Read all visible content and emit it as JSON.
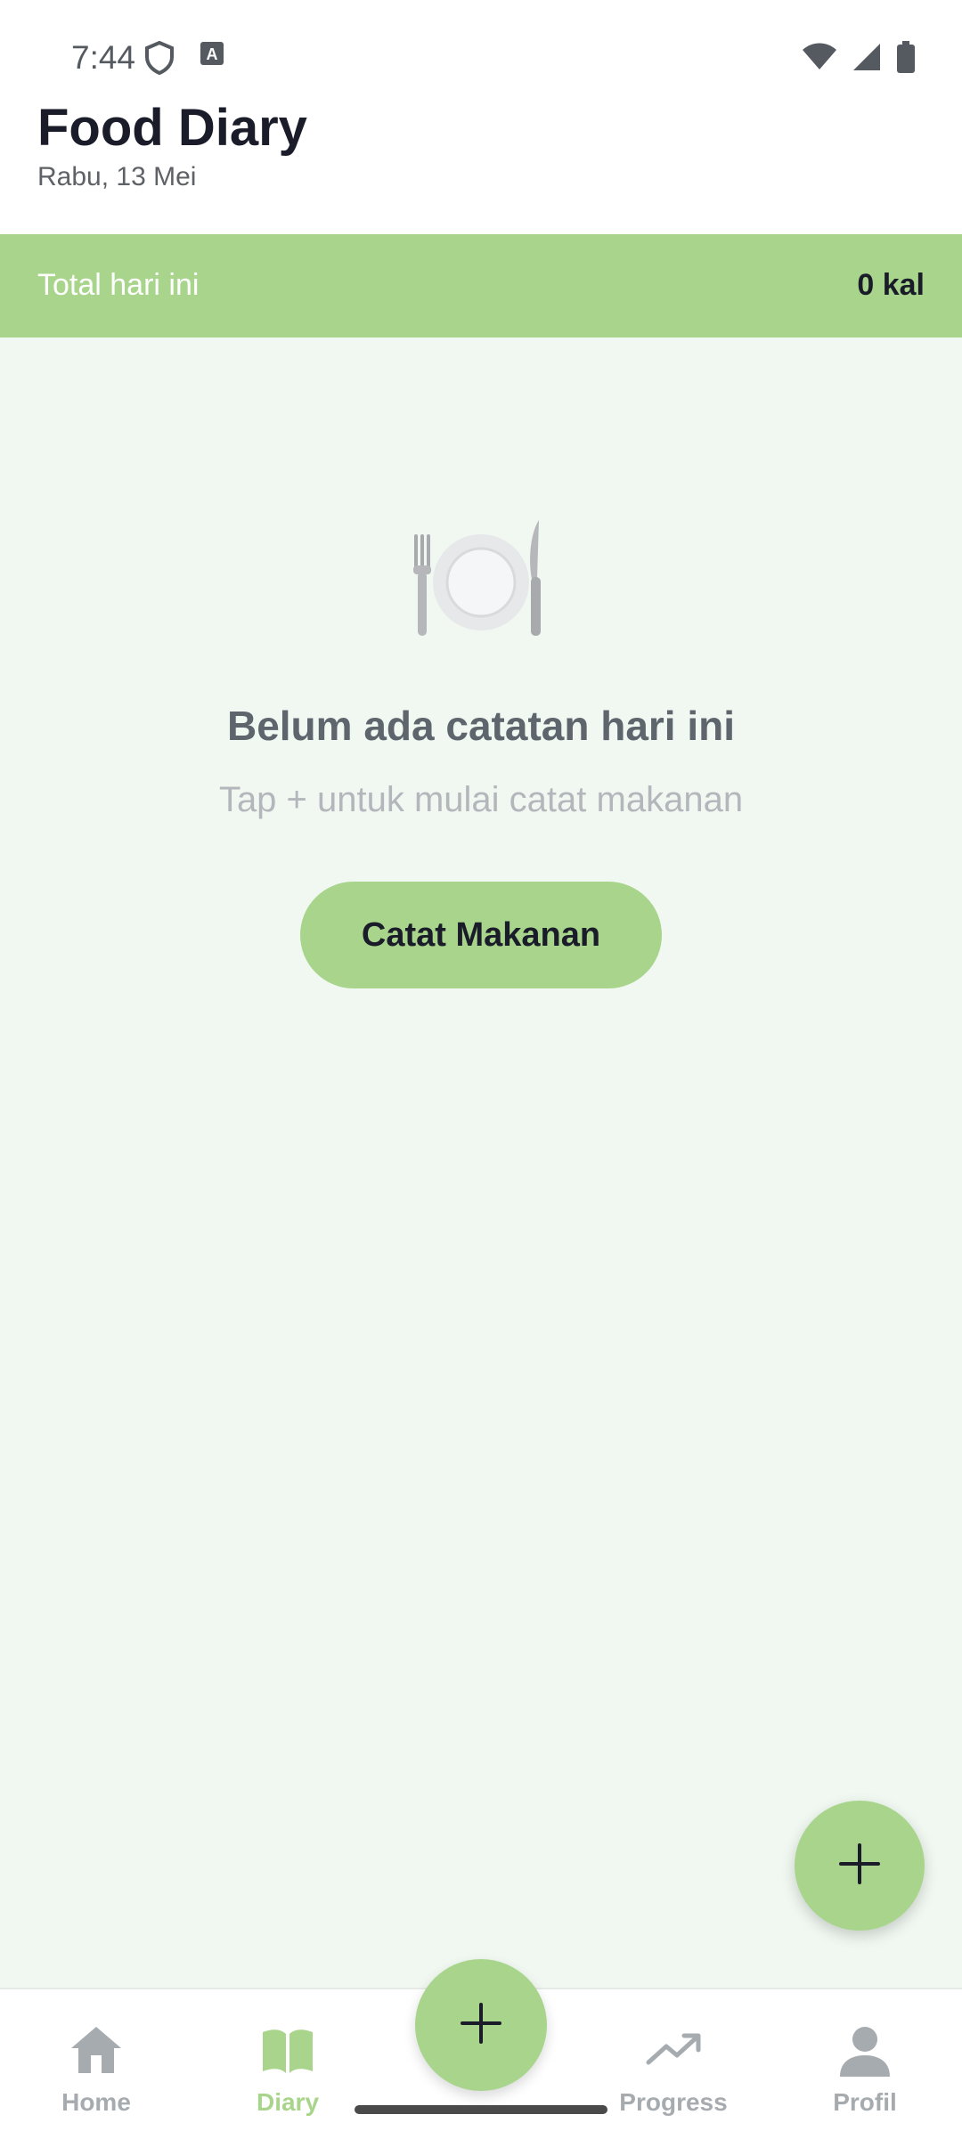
{
  "status": {
    "time": "7:44",
    "icons": [
      "shield-icon",
      "font-icon",
      "wifi-icon",
      "signal-icon",
      "battery-icon"
    ]
  },
  "header": {
    "title": "Food Diary",
    "date": "Rabu, 13 Mei"
  },
  "summary": {
    "label": "Total hari ini",
    "value": "0 kal"
  },
  "empty_state": {
    "icon": "plate-cutlery-icon",
    "title": "Belum ada catatan hari ini",
    "subtitle": "Tap + untuk mulai catat makanan",
    "button_label": "Catat Makanan"
  },
  "fab": {
    "icon": "plus-icon"
  },
  "bottom_nav": {
    "items": [
      {
        "label": "Home",
        "icon": "home-icon",
        "active": false
      },
      {
        "label": "Diary",
        "icon": "book-icon",
        "active": true
      },
      {
        "label": "Progress",
        "icon": "trend-icon",
        "active": false
      },
      {
        "label": "Profil",
        "icon": "person-icon",
        "active": false
      }
    ],
    "center_icon": "plus-icon"
  },
  "colors": {
    "accent": "#a8d58b",
    "background": "#f0f8f1",
    "text_dark": "#1b1c29",
    "nav_inactive": "#a6abb0"
  }
}
